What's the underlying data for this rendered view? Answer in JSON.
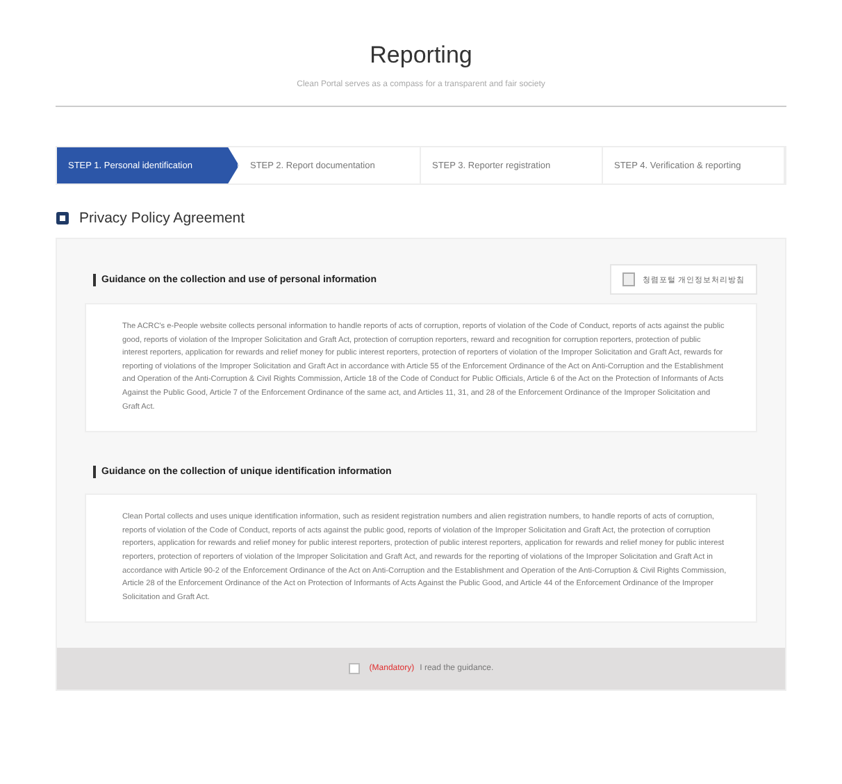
{
  "header": {
    "title": "Reporting",
    "subtitle": "Clean Portal serves as a compass for a transparent and fair society"
  },
  "steps": [
    {
      "label": "STEP 1. Personal identification",
      "selected": true
    },
    {
      "label": "STEP 2. Report documentation",
      "selected": false
    },
    {
      "label": "STEP 3. Reporter registration",
      "selected": false
    },
    {
      "label": "STEP 4. Verification & reporting",
      "selected": false
    }
  ],
  "section_title": "Privacy Policy Agreement",
  "guidance": [
    {
      "title": "Guidance on the collection and use of personal information",
      "button": "청렴포털 개인정보처리방침",
      "text": "The ACRC's e-People website collects personal information to handle reports of acts of corruption, reports of violation of the Code of Conduct, reports of acts against the public good, reports of violation of the Improper Solicitation and Graft Act, protection of corruption reporters, reward and recognition for corruption reporters, protection of public interest reporters, application for rewards and relief money for public interest reporters, protection of reporters of violation of the Improper Solicitation and Graft Act, rewards for reporting of violations of the Improper Solicitation and Graft Act in accordance with Article 55 of the Enforcement Ordinance of the Act on Anti-Corruption and the Establishment and Operation of the Anti-Corruption & Civil Rights Commission, Article 18 of the Code of Conduct for Public Officials, Article 6 of the Act on the Protection of Informants of Acts Against the Public Good, Article 7 of the Enforcement Ordinance of the same act, and Articles 11, 31, and 28 of the Enforcement Ordinance of the Improper Solicitation and Graft Act."
    },
    {
      "title": "Guidance on the collection of unique identification information",
      "text": "Clean Portal collects and uses unique identification information, such as resident registration numbers and alien registration numbers, to handle reports of acts of corruption, reports of violation of the Code of Conduct, reports of acts against the public good, reports of violation of the Improper Solicitation and Graft Act, the protection of corruption reporters, application for rewards and relief money for public interest reporters, protection of public interest reporters, application for rewards and relief money for public interest reporters, protection of reporters of violation of the Improper Solicitation and Graft Act, and rewards for the reporting of violations of the Improper Solicitation and Graft Act in accordance with Article 90-2 of the Enforcement Ordinance of the Act on Anti-Corruption and the Establishment and Operation of the Anti-Corruption & Civil Rights Commission, Article 28 of the Enforcement Ordinance of the Act on Protection of Informants of Acts Against the Public Good, and Article 44 of the Enforcement Ordinance of the Improper Solicitation and Graft Act."
    }
  ],
  "agreement": {
    "checked": false,
    "mandatory": "(Mandatory)",
    "label": "I read the guidance."
  }
}
